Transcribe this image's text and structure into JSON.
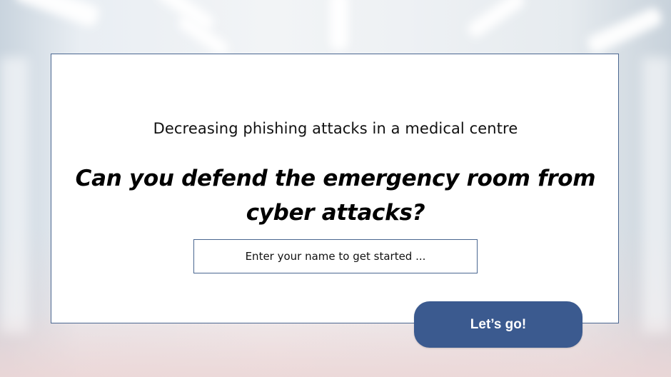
{
  "colors": {
    "card_border": "#4a6690",
    "button_bg": "#3b5a8f",
    "button_text": "#ffffff"
  },
  "intro": {
    "subtitle": "Decreasing phishing attacks in a medical centre",
    "headline": "Can you defend the emergency room from cyber attacks?"
  },
  "form": {
    "name_placeholder": "Enter your name to get started ...",
    "name_value": "",
    "submit_label": "Let’s go!"
  }
}
